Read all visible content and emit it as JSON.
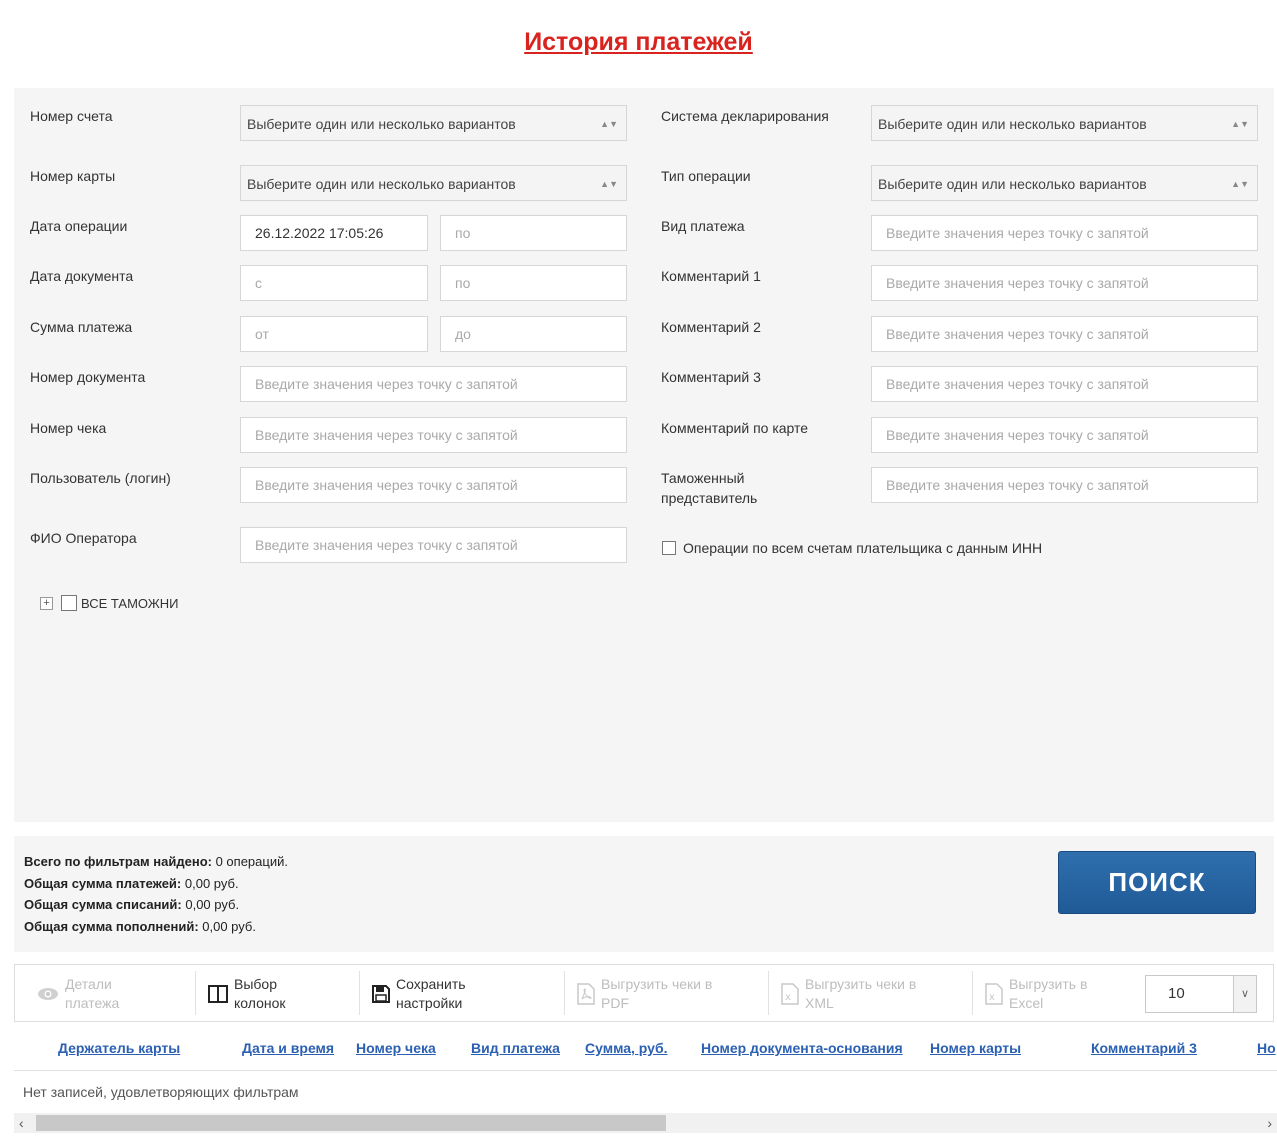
{
  "page": {
    "title": "История платежей"
  },
  "filters": {
    "account_number": {
      "label": "Номер счета",
      "placeholder": "Выберите один или несколько вариантов"
    },
    "declaration_system": {
      "label": "Система декларирования",
      "placeholder": "Выберите один или несколько вариантов"
    },
    "card_number": {
      "label": "Номер карты",
      "placeholder": "Выберите один или несколько вариантов"
    },
    "operation_type": {
      "label": "Тип операции",
      "placeholder": "Выберите один или несколько вариантов"
    },
    "operation_date": {
      "label": "Дата операции",
      "from_value": "26.12.2022 17:05:26",
      "to_placeholder": "по"
    },
    "payment_kind": {
      "label": "Вид платежа",
      "placeholder": "Введите значения через точку с запятой"
    },
    "document_date": {
      "label": "Дата документа",
      "from_placeholder": "с",
      "to_placeholder": "по"
    },
    "comment1": {
      "label": "Комментарий 1",
      "placeholder": "Введите значения через точку с запятой"
    },
    "payment_amount": {
      "label": "Сумма платежа",
      "from_placeholder": "от",
      "to_placeholder": "до"
    },
    "comment2": {
      "label": "Комментарий 2",
      "placeholder": "Введите значения через точку с запятой"
    },
    "document_number": {
      "label": "Номер документа",
      "placeholder": "Введите значения через точку с запятой"
    },
    "comment3": {
      "label": "Комментарий 3",
      "placeholder": "Введите значения через точку с запятой"
    },
    "receipt_number": {
      "label": "Номер чека",
      "placeholder": "Введите значения через точку с запятой"
    },
    "card_comment": {
      "label": "Комментарий по карте",
      "placeholder": "Введите значения через точку с запятой"
    },
    "user_login": {
      "label": "Пользователь (логин)",
      "placeholder": "Введите значения через точку с запятой"
    },
    "customs_rep": {
      "label": "Таможенный представитель",
      "placeholder": "Введите значения через точку с запятой"
    },
    "operator_name": {
      "label": "ФИО Оператора",
      "placeholder": "Введите значения через точку с запятой"
    },
    "all_accounts_inn": {
      "label": "Операции по всем счетам плательщика с данным ИНН"
    },
    "all_customs": {
      "label": "ВСЕ ТАМОЖНИ"
    }
  },
  "summary": {
    "found_label": "Всего по фильтрам найдено:",
    "found_value": " 0 операций.",
    "total_label": "Общая сумма платежей:",
    "total_value": " 0,00 руб.",
    "debit_label": "Общая сумма списаний:",
    "debit_value": " 0,00 руб.",
    "credit_label": "Общая сумма пополнений:",
    "credit_value": " 0,00 руб.",
    "search_button": "ПОИСК"
  },
  "toolbar": {
    "details_1": "Детали",
    "details_2": "платежа",
    "columns_1": "Выбор",
    "columns_2": "колонок",
    "save_1": "Сохранить",
    "save_2": "настройки",
    "pdf_1": "Выгрузить чеки в",
    "pdf_2": "PDF",
    "xml_1": "Выгрузить чеки в",
    "xml_2": "XML",
    "excel_1": "Выгрузить в",
    "excel_2": "Excel",
    "page_size": "10"
  },
  "table": {
    "columns": [
      "Держатель карты",
      "Дата и время",
      "Номер чека",
      "Вид платежа",
      "Сумма, руб.",
      "Номер документа-основания",
      "Номер карты",
      "Комментарий 3",
      "Но"
    ],
    "empty_message": "Нет записей, удовлетворяющих фильтрам"
  },
  "colors": {
    "title": "#d9231e",
    "link": "#2b60b2",
    "button": "#1f5a96"
  }
}
